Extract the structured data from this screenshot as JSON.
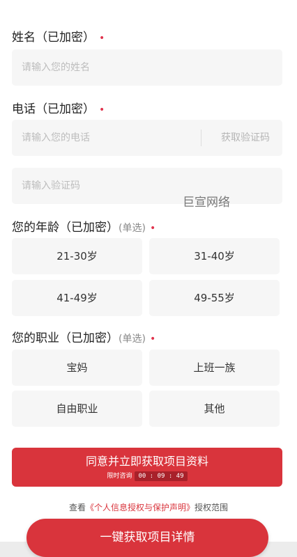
{
  "name_section": {
    "label": "姓名（已加密）",
    "required_mark": "•",
    "placeholder": "请输入您的姓名"
  },
  "phone_section": {
    "label": "电话（已加密）",
    "required_mark": "•",
    "placeholder": "请输入您的电话",
    "code_button": "获取验证码"
  },
  "code_field": {
    "placeholder": "请输入验证码"
  },
  "watermark": "巨宣网络",
  "age_section": {
    "label": "您的年龄（已加密）",
    "hint": "(单选)",
    "required_mark": "•",
    "options": [
      "21-30岁",
      "31-40岁",
      "41-49岁",
      "49-55岁"
    ]
  },
  "job_section": {
    "label": "您的职业（已加密）",
    "hint": "(单选)",
    "required_mark": "•",
    "options": [
      "宝妈",
      "上班一族",
      "自由职业",
      "其他"
    ]
  },
  "submit": {
    "label": "同意并立即获取项目资料",
    "timer_prefix": "限时咨询",
    "timer": "00 : 09 : 49"
  },
  "authorization": {
    "prefix": "查看",
    "link": "《个人信息授权与保护声明》",
    "suffix": "授权范围"
  },
  "cta_button": "一键获取项目详情",
  "colors": {
    "accent": "#d9343c",
    "required": "#e0334d",
    "field_bg": "#f6f6f6"
  }
}
